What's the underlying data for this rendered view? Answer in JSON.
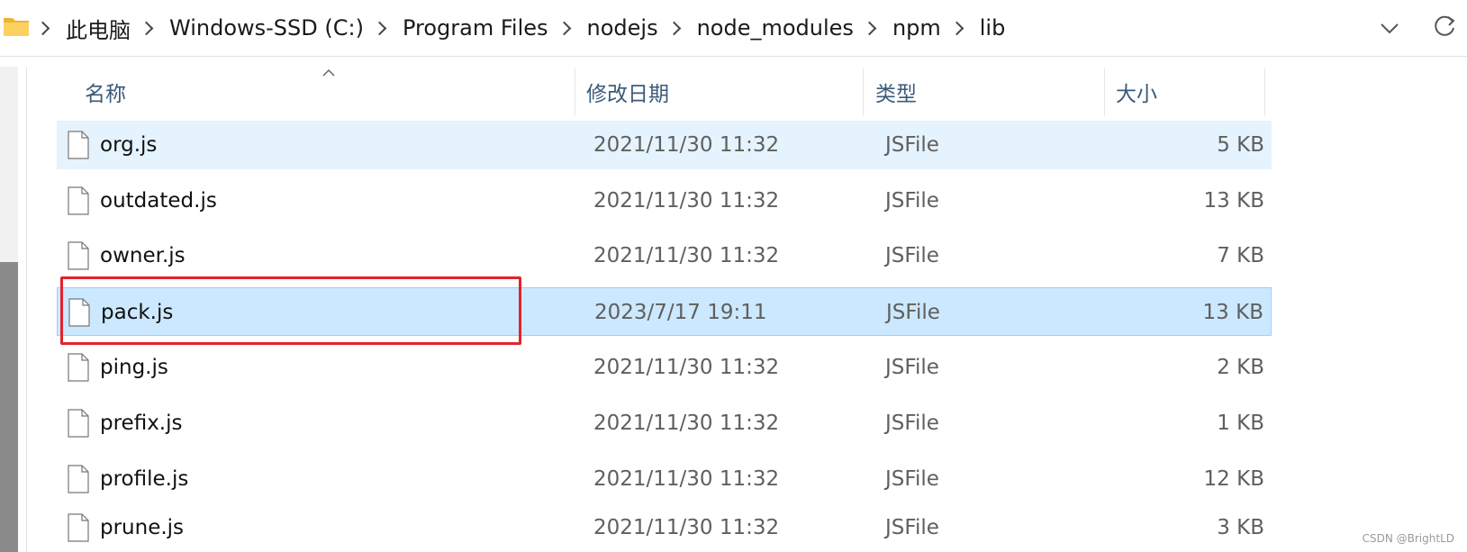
{
  "address_bar": {
    "breadcrumbs": [
      "此电脑",
      "Windows-SSD (C:)",
      "Program Files",
      "nodejs",
      "node_modules",
      "npm",
      "lib"
    ]
  },
  "columns": {
    "name": "名称",
    "date": "修改日期",
    "type": "类型",
    "size": "大小"
  },
  "files": [
    {
      "name": "org.js",
      "date": "2021/11/30 11:32",
      "type": "JSFile",
      "size": "5 KB"
    },
    {
      "name": "outdated.js",
      "date": "2021/11/30 11:32",
      "type": "JSFile",
      "size": "13 KB"
    },
    {
      "name": "owner.js",
      "date": "2021/11/30 11:32",
      "type": "JSFile",
      "size": "7 KB"
    },
    {
      "name": "pack.js",
      "date": "2023/7/17 19:11",
      "type": "JSFile",
      "size": "13 KB"
    },
    {
      "name": "ping.js",
      "date": "2021/11/30 11:32",
      "type": "JSFile",
      "size": "2 KB"
    },
    {
      "name": "prefix.js",
      "date": "2021/11/30 11:32",
      "type": "JSFile",
      "size": "1 KB"
    },
    {
      "name": "profile.js",
      "date": "2021/11/30 11:32",
      "type": "JSFile",
      "size": "12 KB"
    },
    {
      "name": "prune.js",
      "date": "2021/11/30 11:32",
      "type": "JSFile",
      "size": "3 KB"
    }
  ],
  "watermark": "CSDN @BrightLD",
  "colors": {
    "hover_row": "#e5f3ff",
    "selected_row": "#cce8ff",
    "annotation_box": "#e1232e",
    "header_text": "#3b5a7a"
  }
}
